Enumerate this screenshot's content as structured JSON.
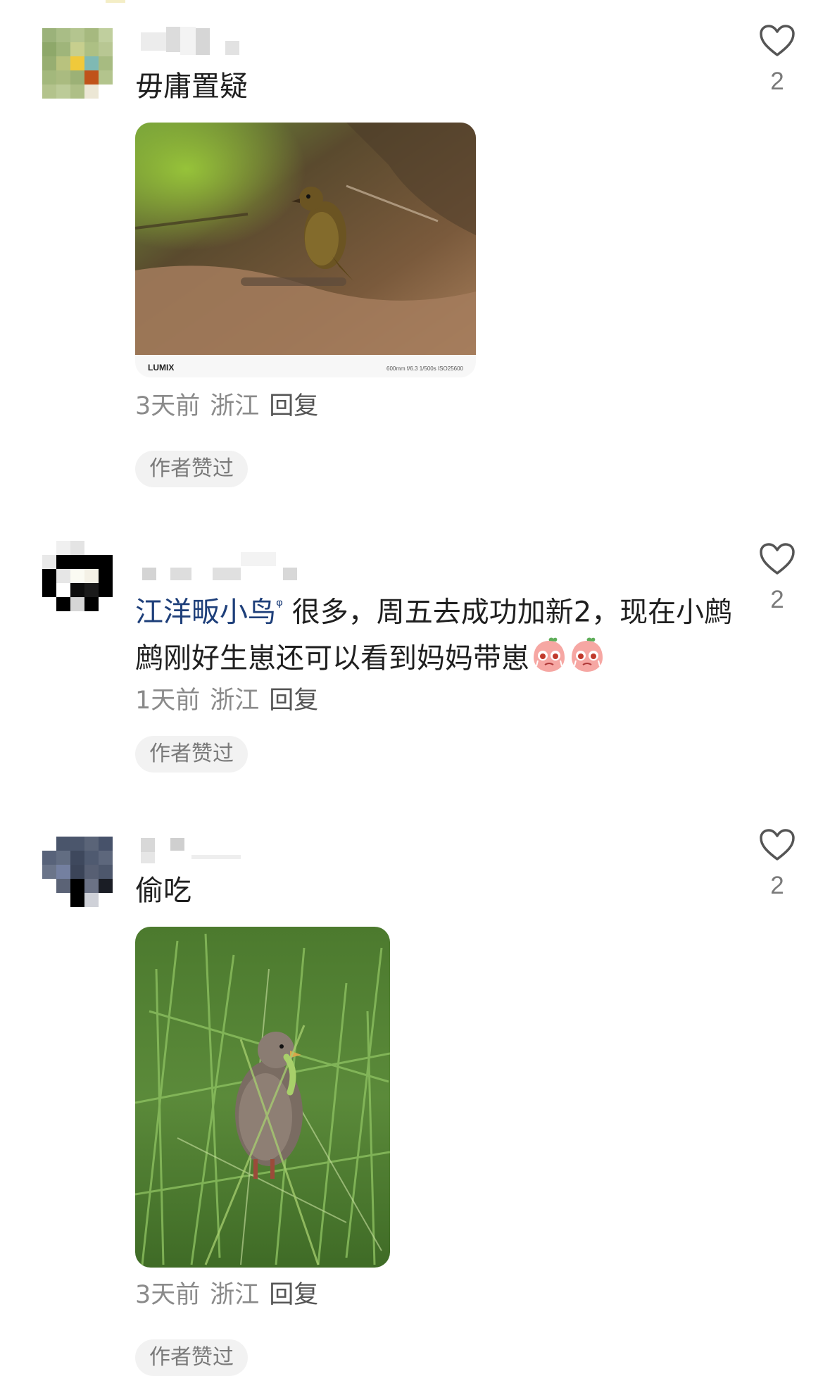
{
  "comments": [
    {
      "text": "毋庸置疑",
      "time": "3天前",
      "location": "浙江",
      "reply_label": "回复",
      "badge": "作者赞过",
      "likes": "2",
      "photo_watermark": {
        "brand": "LUMIX",
        "exif": "600mm  f/6.3  1/500s  ISO25600"
      }
    },
    {
      "mention": "江洋畈小鸟",
      "text": " 很多，周五去成功加新2，现在小鹧鹧刚好生崽还可以看到妈妈带崽",
      "time": "1天前",
      "location": "浙江",
      "reply_label": "回复",
      "badge": "作者赞过",
      "likes": "2"
    },
    {
      "text": "偷吃",
      "time": "3天前",
      "location": "浙江",
      "reply_label": "回复",
      "badge": "作者赞过",
      "likes": "2"
    }
  ],
  "icons": {
    "like": "heart-outline-icon",
    "mention_marker": "search-mention-icon",
    "emoji": "crying-peach-emoji-icon"
  },
  "colors": {
    "text": "#1f1f1f",
    "meta": "#8a8a8a",
    "mention": "#1e3f7a",
    "badge_bg": "#f2f2f2"
  }
}
